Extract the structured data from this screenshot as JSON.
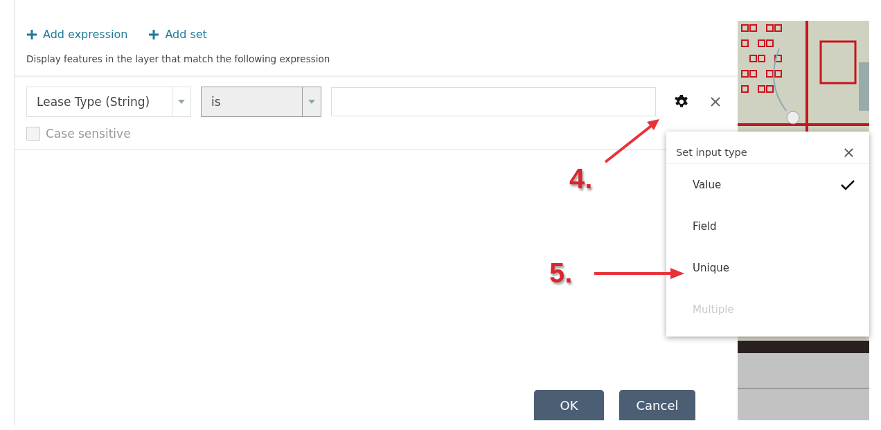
{
  "toolbar": [
    {
      "label": "Add expression"
    },
    {
      "label": "Add set"
    }
  ],
  "description": "Display features in the layer that match the following expression",
  "expression": {
    "field": "Lease Type (String)",
    "operator": "is",
    "case_sensitive": {
      "label": "Case sensitive",
      "checked": false
    }
  },
  "input_type_menu": {
    "title": "Set input type",
    "items": [
      {
        "label": "Value",
        "selected": true,
        "disabled": false
      },
      {
        "label": "Field",
        "selected": false,
        "disabled": false
      },
      {
        "label": "Unique",
        "selected": false,
        "disabled": false
      },
      {
        "label": "Multiple",
        "selected": false,
        "disabled": true
      }
    ]
  },
  "annotations": [
    {
      "label": "4."
    },
    {
      "label": "5."
    }
  ],
  "buttons": [
    {
      "label": "OK"
    },
    {
      "label": "Cancel"
    }
  ]
}
